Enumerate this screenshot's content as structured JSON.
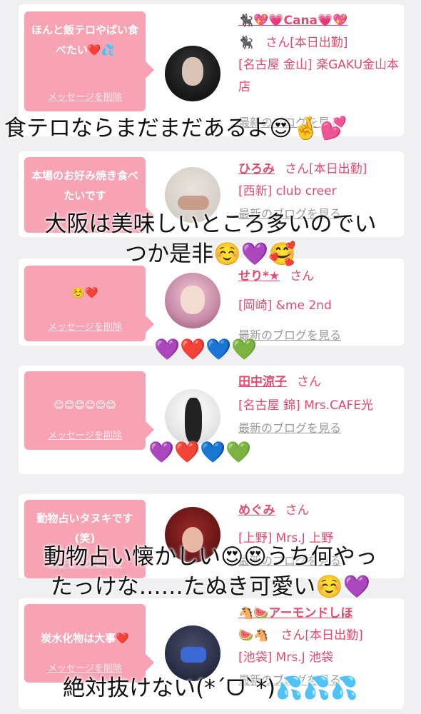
{
  "cards": [
    {
      "message": "ほんと飯テロやばい食べたい❤️💦",
      "delete_label": "メッセージを削除",
      "name": "🐈‍⬛💖💗Cana💗💖",
      "san": "🐈‍⬛　さん[本日出勤]",
      "location": "[名古屋 金山] 楽GAKU金山本店",
      "blog": "最新のブログを見る"
    },
    {
      "message": "本場のお好み焼き食べたいです",
      "delete_label": "メッセージを削除",
      "name": "ひろみ",
      "san": "さん[本日出勤]",
      "location": "[西新] club creer",
      "blog": "最新のブログを見る"
    },
    {
      "message": "☺️❤️",
      "delete_label": "メッセージを削除",
      "name": "せり*★",
      "san": "さん",
      "location": "[岡崎] &me 2nd",
      "blog": "最新のブログを見る"
    },
    {
      "message": "😊😊😊😊😊😊",
      "delete_label": "メッセージを削除",
      "name": "田中涼子",
      "san": "さん",
      "location": "[名古屋 錦] Mrs.CAFE光",
      "blog": "最新のブログを見る"
    },
    {
      "message": "動物占いタヌキです(笑)",
      "delete_label": "メッセージを削除",
      "name": "めぐみ",
      "san": "さん",
      "location": "[上野] Mrs.J 上野",
      "blog": "最新のブログを見る"
    },
    {
      "message": "炭水化物は大事❤️",
      "delete_label": "メッセージを削除",
      "name": "🐴🍉アーモンドしほ",
      "san": "🍉🐴　さん[本日出勤]",
      "location": "[池袋] Mrs.J 池袋",
      "blog": "最新のブログを見る"
    }
  ],
  "captions": {
    "c1": "食テロならまだまだあるよ😍🤞💕",
    "c2_line1": "大阪は美味しいところ多いのでい",
    "c2_line2": "つか是非☺️💜🥰",
    "c3": "💜❤️💙💚",
    "c4": "💜❤️💙💚",
    "c5_line1": "動物占い懐かしい😍😍うち何やっ",
    "c5_line2": "たっけな……たぬき可愛い☺️💜",
    "c6": "絶対抜けない(*´ᗜ`*)💦💦💦"
  },
  "colors": {
    "bubble": "#f7a3b4",
    "accent": "#e24a6e",
    "background": "#f0f0f2"
  }
}
